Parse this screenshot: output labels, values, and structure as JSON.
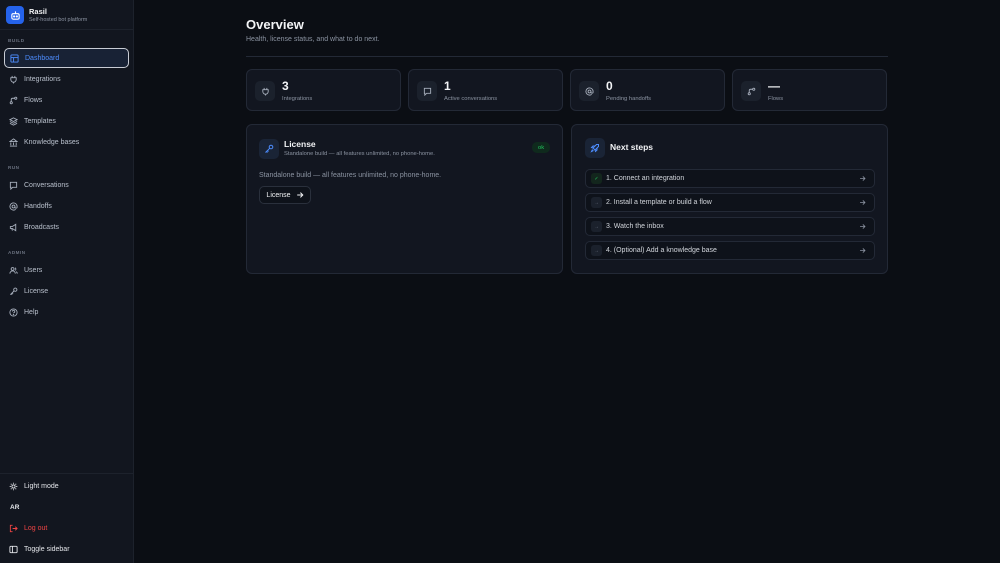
{
  "brand": {
    "name": "Rasil",
    "subtitle": "Self-hosted bot platform"
  },
  "sidebar": {
    "sections": {
      "build": "BUILD",
      "run": "RUN",
      "admin": "ADMIN"
    },
    "items": {
      "dashboard": "Dashboard",
      "integrations": "Integrations",
      "flows": "Flows",
      "templates": "Templates",
      "knowledge_bases": "Knowledge bases",
      "conversations": "Conversations",
      "handoffs": "Handoffs",
      "broadcasts": "Broadcasts",
      "users": "Users",
      "license": "License",
      "help": "Help"
    },
    "light_mode": "Light mode",
    "user_initials": "AR",
    "log_out": "Log out",
    "toggle_sidebar": "Toggle sidebar"
  },
  "header": {
    "title": "Overview",
    "subtitle": "Health, license status, and what to do next."
  },
  "stats": [
    {
      "value": "3",
      "label": "Integrations",
      "icon": "plug-icon"
    },
    {
      "value": "1",
      "label": "Active conversations",
      "icon": "message-icon"
    },
    {
      "value": "0",
      "label": "Pending handoffs",
      "icon": "at-icon"
    },
    {
      "value": "—",
      "label": "Flows",
      "icon": "flow-icon"
    }
  ],
  "license": {
    "title": "License",
    "subtitle": "Standalone build — all features unlimited, no phone-home.",
    "status": "ok",
    "body": "Standalone build — all features unlimited, no phone-home.",
    "button": "License"
  },
  "next_steps": {
    "title": "Next steps",
    "items": [
      {
        "label": "1. Connect an integration",
        "done": true
      },
      {
        "label": "2. Install a template or build a flow",
        "done": false
      },
      {
        "label": "3. Watch the inbox",
        "done": false
      },
      {
        "label": "4. (Optional) Add a knowledge base",
        "done": false
      }
    ]
  },
  "colors": {
    "accent": "#2563eb",
    "link": "#4d8dff",
    "success": "#22c55e",
    "danger": "#ef4444",
    "background": "#0b0e14"
  }
}
